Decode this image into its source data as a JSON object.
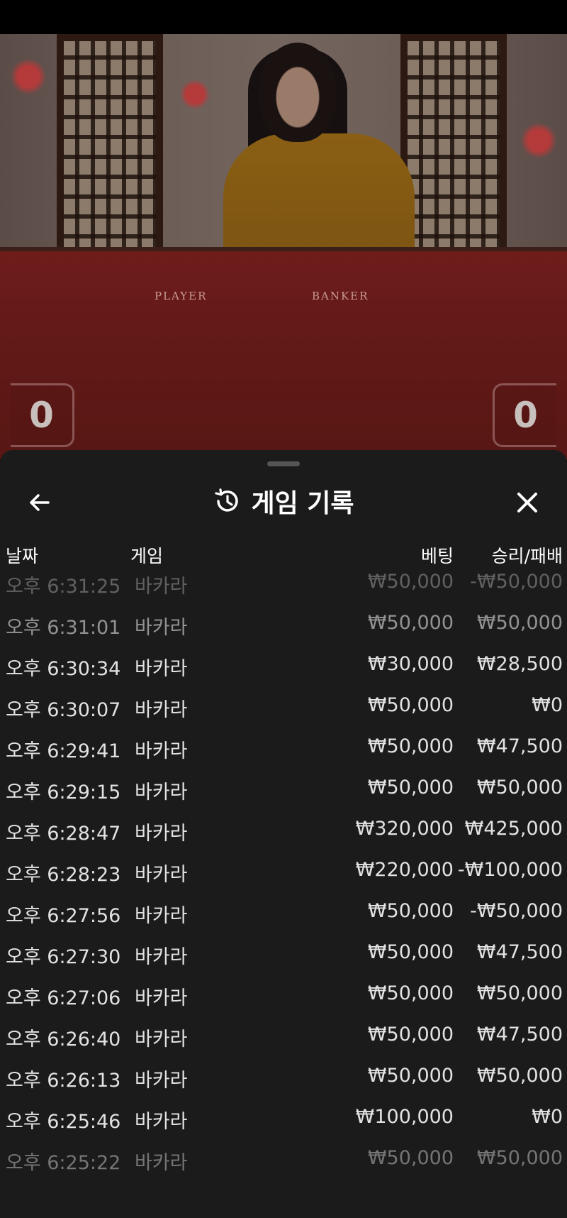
{
  "video": {
    "table_labels": {
      "player": "PLAYER",
      "banker": "BANKER"
    },
    "scores": {
      "player": "0",
      "banker": "0"
    }
  },
  "sheet": {
    "title": "게임 기록",
    "icons": {
      "back": "arrow-left-icon",
      "title": "history-icon",
      "close": "close-icon"
    }
  },
  "table": {
    "headers": {
      "date": "날짜",
      "game": "게임",
      "bet": "베팅",
      "result": "승리/패배"
    },
    "rows": [
      {
        "time": "오후 6:31:25",
        "game": "바카라",
        "bet": "₩50,000",
        "result": "-₩50,000"
      },
      {
        "time": "오후 6:31:01",
        "game": "바카라",
        "bet": "₩50,000",
        "result": "₩50,000"
      },
      {
        "time": "오후 6:30:34",
        "game": "바카라",
        "bet": "₩30,000",
        "result": "₩28,500"
      },
      {
        "time": "오후 6:30:07",
        "game": "바카라",
        "bet": "₩50,000",
        "result": "₩0"
      },
      {
        "time": "오후 6:29:41",
        "game": "바카라",
        "bet": "₩50,000",
        "result": "₩47,500"
      },
      {
        "time": "오후 6:29:15",
        "game": "바카라",
        "bet": "₩50,000",
        "result": "₩50,000"
      },
      {
        "time": "오후 6:28:47",
        "game": "바카라",
        "bet": "₩320,000",
        "result": "₩425,000"
      },
      {
        "time": "오후 6:28:23",
        "game": "바카라",
        "bet": "₩220,000",
        "result": "-₩100,000"
      },
      {
        "time": "오후 6:27:56",
        "game": "바카라",
        "bet": "₩50,000",
        "result": "-₩50,000"
      },
      {
        "time": "오후 6:27:30",
        "game": "바카라",
        "bet": "₩50,000",
        "result": "₩47,500"
      },
      {
        "time": "오후 6:27:06",
        "game": "바카라",
        "bet": "₩50,000",
        "result": "₩50,000"
      },
      {
        "time": "오후 6:26:40",
        "game": "바카라",
        "bet": "₩50,000",
        "result": "₩47,500"
      },
      {
        "time": "오후 6:26:13",
        "game": "바카라",
        "bet": "₩50,000",
        "result": "₩50,000"
      },
      {
        "time": "오후 6:25:46",
        "game": "바카라",
        "bet": "₩100,000",
        "result": "₩0"
      },
      {
        "time": "오후 6:25:22",
        "game": "바카라",
        "bet": "₩50,000",
        "result": "₩50,000"
      }
    ]
  }
}
